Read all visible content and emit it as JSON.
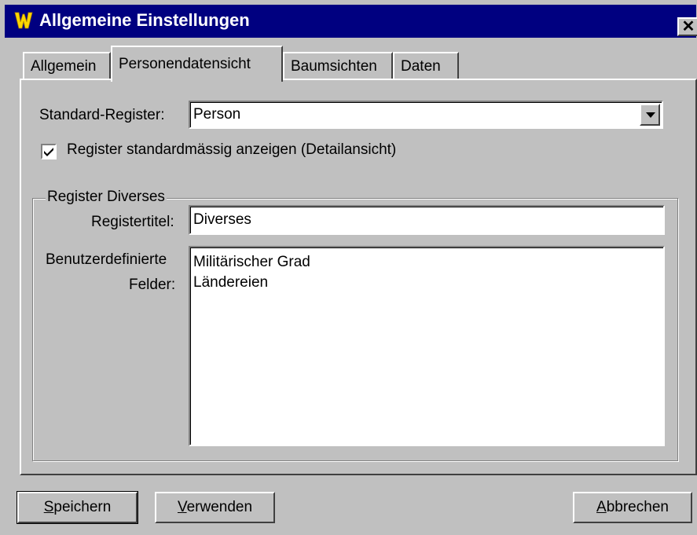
{
  "window": {
    "title": "Allgemeine Einstellungen",
    "close_glyph": "✕",
    "icon": "app-w-icon"
  },
  "tabs": [
    {
      "label": "Allgemein",
      "active": false
    },
    {
      "label": "Personendatensicht",
      "active": true
    },
    {
      "label": "Baumsichten",
      "active": false
    },
    {
      "label": "Daten",
      "active": false
    }
  ],
  "standard_register": {
    "label": "Standard-Register:",
    "value": "Person"
  },
  "show_register": {
    "label": "Register standardmässig anzeigen (Detailansicht)",
    "checked": true
  },
  "group": {
    "title": "Register Diverses",
    "registertitel": {
      "label": "Registertitel:",
      "value": "Diverses"
    },
    "custom_fields": {
      "label_line1": "Benutzerdefinierte",
      "label_line2": "Felder:",
      "items": [
        "Militärischer Grad",
        "Ländereien"
      ]
    }
  },
  "buttons": {
    "save": {
      "accel": "S",
      "rest": "peichern"
    },
    "apply": {
      "accel": "V",
      "rest": "erwenden"
    },
    "cancel": {
      "accel": "A",
      "rest": "bbrechen"
    }
  }
}
